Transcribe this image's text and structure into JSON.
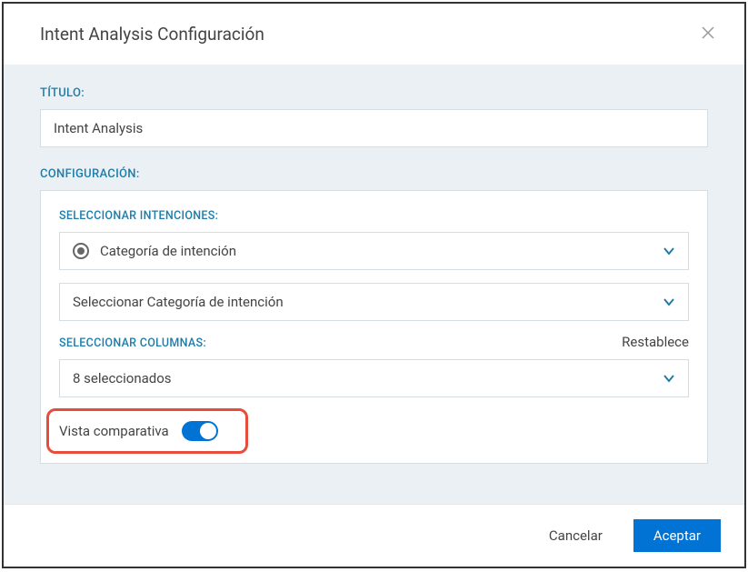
{
  "modal": {
    "title": "Intent Analysis Configuración"
  },
  "titleSection": {
    "label": "TÍTULO:",
    "value": "Intent Analysis"
  },
  "configSection": {
    "label": "CONFIGURACIÓN:",
    "intentions": {
      "label": "SELECCIONAR INTENCIONES:",
      "categoryDropdown": "Categoría de intención",
      "selectCategoryDropdown": "Seleccionar Categoría de intención"
    },
    "columns": {
      "label": "SELECCIONAR COLUMNAS:",
      "resetLabel": "Restablece",
      "selectedText": "8 seleccionados"
    },
    "compareView": {
      "label": "Vista comparativa",
      "enabled": true
    }
  },
  "footer": {
    "cancel": "Cancelar",
    "accept": "Aceptar"
  }
}
